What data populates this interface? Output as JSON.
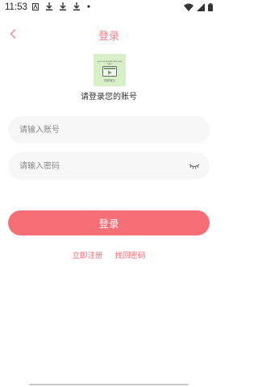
{
  "status_bar": {
    "time": "11:53",
    "left_icons": [
      "a-icon",
      "download-icon",
      "download-icon",
      "download-icon",
      "dot-icon"
    ],
    "right_icons": [
      "wifi-icon",
      "signal-icon",
      "battery-icon"
    ]
  },
  "header": {
    "title": "登录"
  },
  "logo": {
    "line": "your ad placeholder text here",
    "caption": "视频演示"
  },
  "subtitle": "请登录您的账号",
  "form": {
    "account_placeholder": "请输入账号",
    "password_placeholder": "请输入密码"
  },
  "login_button_label": "登录",
  "links": {
    "register": "立即注册",
    "recover": "找回密码"
  },
  "colors": {
    "accent": "#f76f76",
    "title": "#f27f86"
  }
}
